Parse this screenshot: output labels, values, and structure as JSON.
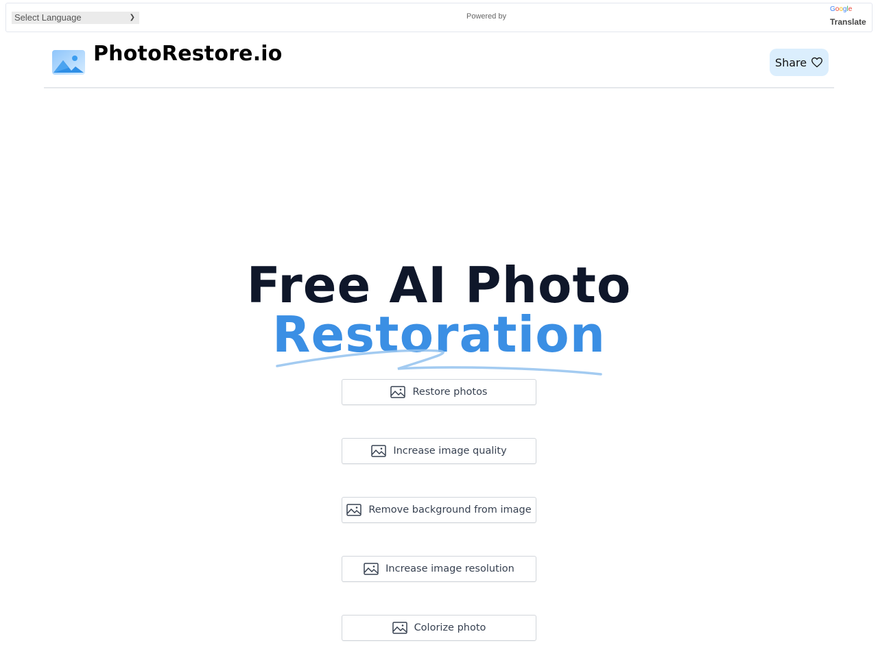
{
  "translate_bar": {
    "select_label": "Select Language",
    "powered_by": "Powered by",
    "google_letters": [
      "G",
      "o",
      "o",
      "g",
      "l",
      "e"
    ],
    "translate_label": "Translate"
  },
  "header": {
    "brand": "PhotoRestore.io",
    "logo_icon": "image-landscape-icon",
    "share_label": "Share",
    "share_icon": "heart-icon"
  },
  "hero": {
    "line1": "Free AI Photo",
    "line2": "Restoration",
    "accent_color": "#3b8fe4",
    "title_color": "#0f172a"
  },
  "tools": [
    {
      "label": "Restore photos",
      "icon": "image-icon"
    },
    {
      "label": "Increase image quality",
      "icon": "image-icon"
    },
    {
      "label": "Remove background from image",
      "icon": "image-icon"
    },
    {
      "label": "Increase image resolution",
      "icon": "image-icon"
    },
    {
      "label": "Colorize photo",
      "icon": "image-icon"
    }
  ]
}
